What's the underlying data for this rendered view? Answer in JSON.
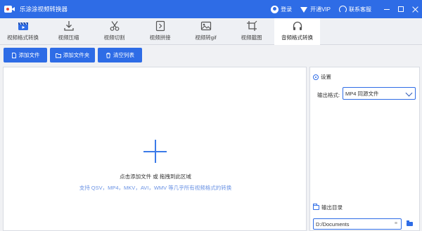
{
  "app": {
    "title": "乐涂涂视频转换器"
  },
  "titlebar": {
    "login_label": "登录",
    "vip_label": "开通VIP",
    "support_label": "联系客服"
  },
  "tabs": [
    {
      "label": "视频格式转换",
      "icon": "video-convert-icon",
      "active": false
    },
    {
      "label": "视频压缩",
      "icon": "download-compress-icon",
      "active": false
    },
    {
      "label": "视频切割",
      "icon": "scissors-icon",
      "active": false
    },
    {
      "label": "视频拼接",
      "icon": "merge-icon",
      "active": false
    },
    {
      "label": "视频转gif",
      "icon": "gif-icon",
      "active": false
    },
    {
      "label": "视频截图",
      "icon": "crop-icon",
      "active": false
    },
    {
      "label": "音频格式转换",
      "icon": "headphones-icon",
      "active": true
    }
  ],
  "toolbar": {
    "add_file_label": "添加文件",
    "add_folder_label": "添加文件夹",
    "clear_list_label": "清空列表"
  },
  "dropzone": {
    "main_text": "点击添加文件 或 拖拽到此区域",
    "sub_text": "支持 QSV，MP4，MKV，AVI，WMV 等几乎所有视频格式的转换"
  },
  "settings": {
    "title": "设置",
    "format_label": "输出格式:",
    "format_value": "MP4 同源文件",
    "output_dir_label": "输出目录",
    "output_dir_value": "D:/Documents",
    "output_dir_suffix": "≡"
  },
  "colors": {
    "accent": "#2e6ce6",
    "subtext": "#6b93e4"
  }
}
